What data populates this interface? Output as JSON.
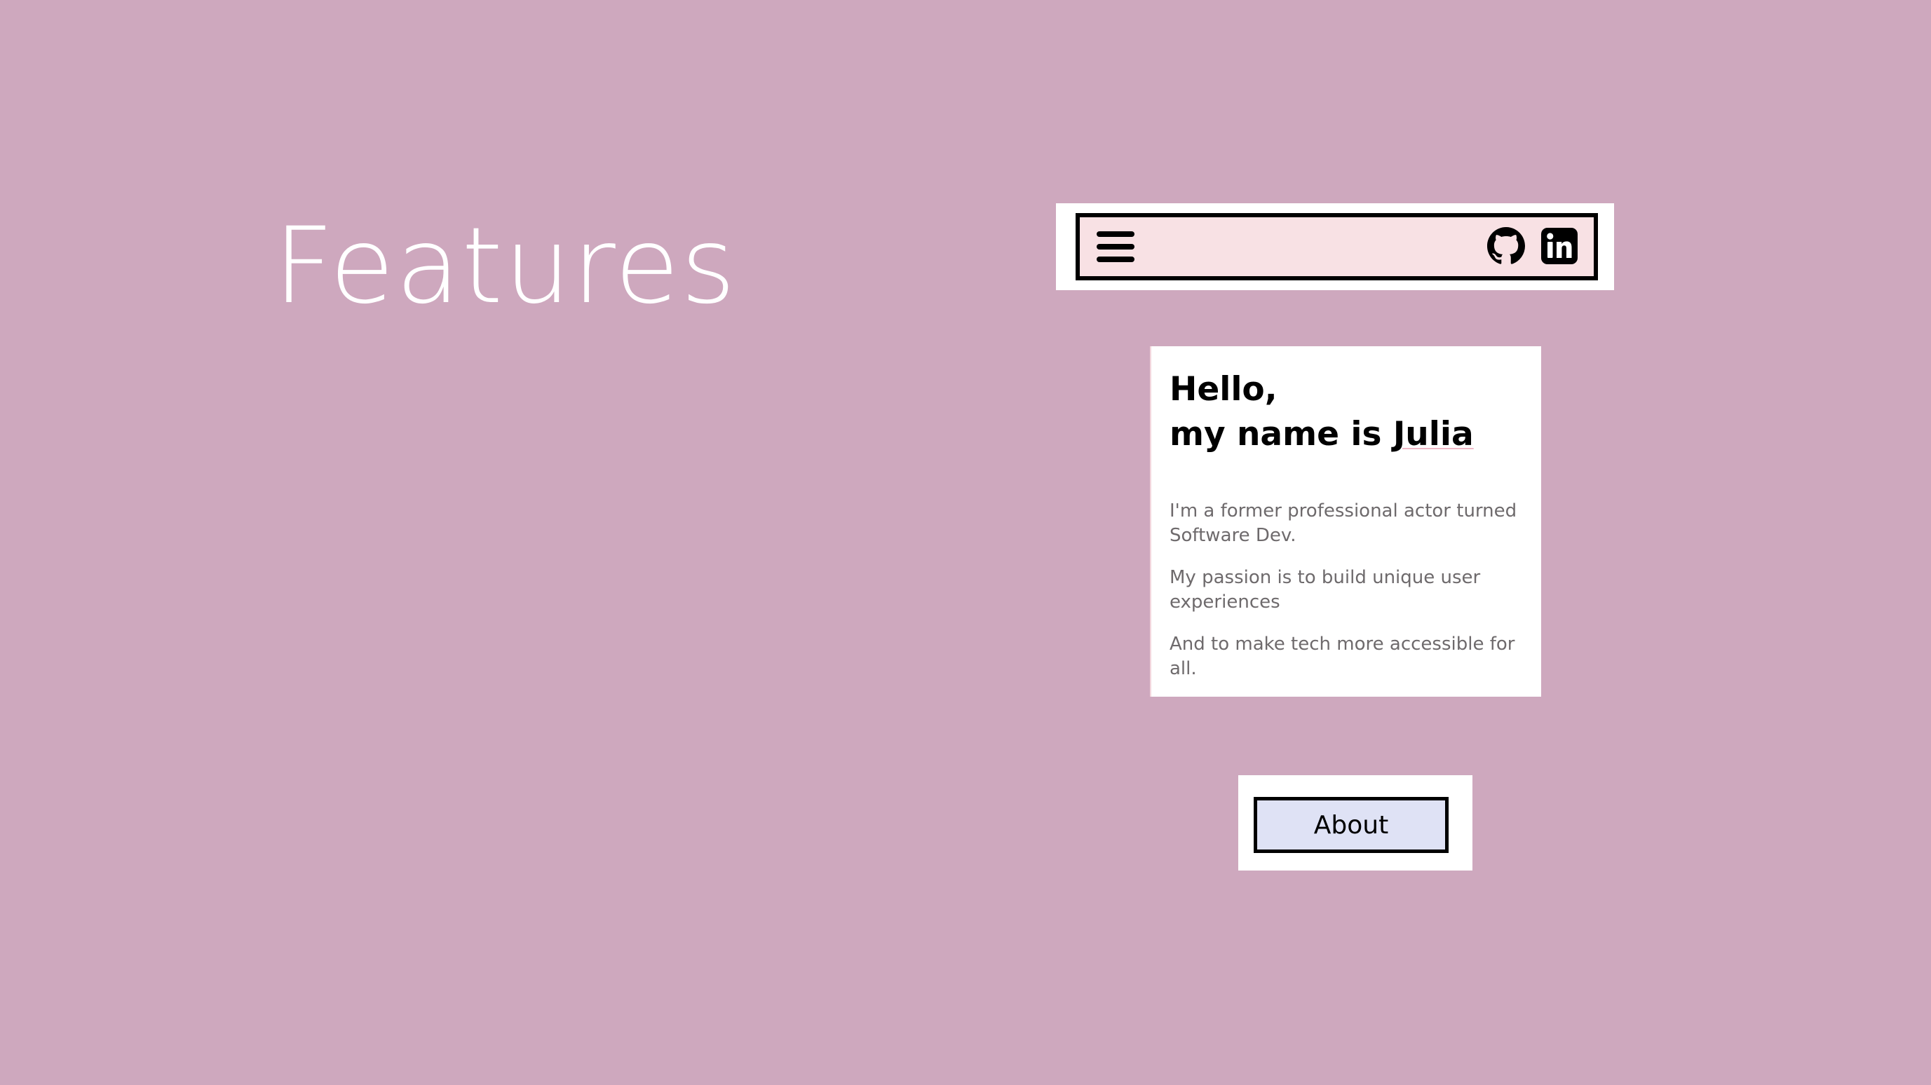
{
  "slide": {
    "title": "Features",
    "background_color": "#cea8be"
  },
  "navbar": {
    "background_color": "#f8e1e4",
    "menu_icon": "hamburger-menu-icon",
    "icons": [
      "github-icon",
      "linkedin-icon"
    ]
  },
  "intro": {
    "greeting": "Hello,",
    "name_prefix": "my name is ",
    "name": "Julia",
    "paragraphs": [
      "I'm a former professional actor turned Software Dev.",
      "My passion is to build unique user experiences",
      "And to make tech more accessible for all."
    ]
  },
  "about": {
    "button_label": "About",
    "button_color": "#dfe2f5"
  }
}
